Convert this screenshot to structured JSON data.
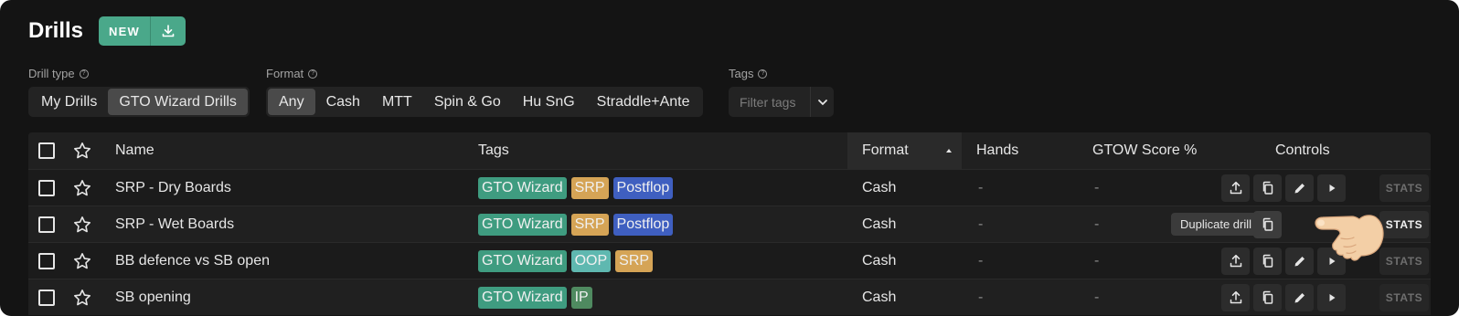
{
  "header": {
    "title": "Drills",
    "new_label": "NEW"
  },
  "filters": {
    "drill_type": {
      "label": "Drill type",
      "options": [
        "My Drills",
        "GTO Wizard Drills"
      ],
      "selected": "GTO Wizard Drills"
    },
    "format": {
      "label": "Format",
      "options": [
        "Any",
        "Cash",
        "MTT",
        "Spin & Go",
        "Hu SnG",
        "Straddle+Ante"
      ],
      "selected": "Any"
    },
    "tags": {
      "label": "Tags",
      "placeholder": "Filter tags"
    }
  },
  "table": {
    "columns": {
      "name": "Name",
      "tags": "Tags",
      "format": "Format",
      "hands": "Hands",
      "score": "GTOW Score %",
      "controls": "Controls"
    },
    "sorted_by": "Format",
    "rows": [
      {
        "name": "SRP - Dry Boards",
        "tags": [
          "GTO Wizard",
          "SRP",
          "Postflop"
        ],
        "format": "Cash",
        "hands": "-",
        "score": "-",
        "stats": "STATS"
      },
      {
        "name": "SRP - Wet Boards",
        "tags": [
          "GTO Wizard",
          "SRP",
          "Postflop"
        ],
        "format": "Cash",
        "hands": "-",
        "score": "-",
        "stats": "STATS"
      },
      {
        "name": "BB defence vs SB open",
        "tags": [
          "GTO Wizard",
          "OOP",
          "SRP"
        ],
        "format": "Cash",
        "hands": "-",
        "score": "-",
        "stats": "STATS"
      },
      {
        "name": "SB opening",
        "tags": [
          "GTO Wizard",
          "IP"
        ],
        "format": "Cash",
        "hands": "-",
        "score": "-",
        "stats": "STATS"
      }
    ]
  },
  "tooltip": "Duplicate drill",
  "colors": {
    "accent": "#4aa88a",
    "tag_gto_wizard": "#3f9c80",
    "tag_srp": "#d5a456",
    "tag_postflop": "#3f5fc0",
    "tag_oop": "#5fb8b0",
    "tag_ip": "#4f8a60"
  },
  "icons": [
    "download-icon",
    "star-icon",
    "upload-icon",
    "copy-icon",
    "pencil-icon",
    "play-icon",
    "pointing-hand-icon",
    "chevron-down-icon",
    "help-icon",
    "sort-up-icon"
  ]
}
